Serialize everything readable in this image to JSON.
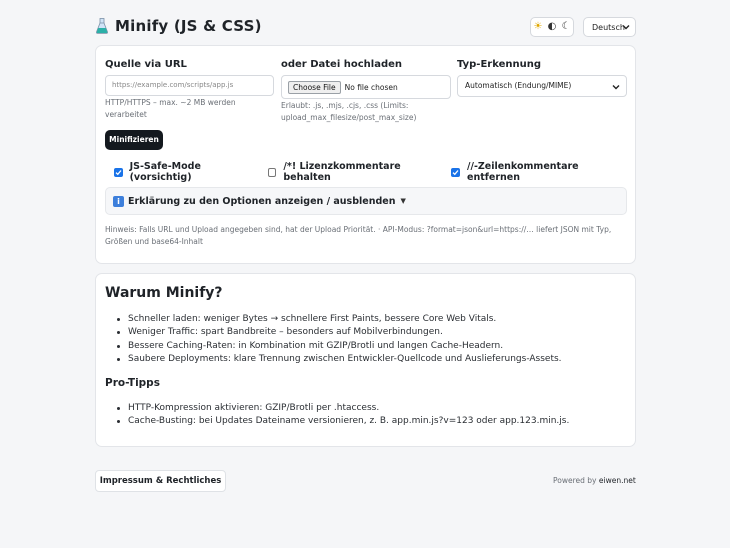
{
  "header": {
    "title": "Minify (JS & CSS)",
    "theme_buttons": [
      {
        "icon": "sun-icon",
        "glyph": "☀"
      },
      {
        "icon": "half-circle-icon",
        "glyph": "◐"
      },
      {
        "icon": "moon-icon",
        "glyph": "☾"
      }
    ],
    "language": "Deutsch"
  },
  "form": {
    "url_label": "Quelle via URL",
    "url_placeholder": "https://example.com/scripts/app.js",
    "url_hint": "HTTP/HTTPS – max. ~2 MB werden verarbeitet",
    "upload_label": "oder Datei hochladen",
    "file_button": "Choose File",
    "file_status": "No file chosen",
    "upload_hint": "Erlaubt: .js, .mjs, .cjs, .css (Limits: upload_max_filesize/post_max_size)",
    "type_label": "Typ-Erkennung",
    "type_value": "Automatisch (Endung/MIME)",
    "submit_label": "Minifizieren",
    "options": [
      {
        "label": "JS-Safe-Mode (vorsichtig)",
        "checked": true
      },
      {
        "label": "/*! Lizenzkommentare behalten",
        "checked": false
      },
      {
        "label": "//-Zeilenkommentare entfernen",
        "checked": true
      }
    ],
    "details_label": "Erklärung zu den Optionen anzeigen / ausblenden",
    "details_marker": "▼",
    "footnote": "Hinweis: Falls URL und Upload angegeben sind, hat der Upload Priorität. · API-Modus: ?format=json&url=https://… liefert JSON mit Typ, Größen und base64-Inhalt"
  },
  "why": {
    "heading": "Warum Minify?",
    "items": [
      "Schneller laden: weniger Bytes → schnellere First Paints, bessere Core Web Vitals.",
      "Weniger Traffic: spart Bandbreite – besonders auf Mobilverbindungen.",
      "Bessere Caching-Raten: in Kombination mit GZIP/Brotli und langen Cache-Headern.",
      "Saubere Deployments: klare Trennung zwischen Entwickler-Quellcode und Auslieferungs-Assets."
    ],
    "tips_heading": "Pro-Tipps",
    "tips": [
      "HTTP-Kompression aktivieren: GZIP/Brotli per .htaccess.",
      "Cache-Busting: bei Updates Dateiname versionieren, z. B. app.min.js?v=123 oder app.123.min.js."
    ]
  },
  "footer": {
    "imprint_label": "Impressum & Rechtliches",
    "powered_prefix": "Powered by",
    "powered_link": "eiwen.net"
  },
  "colors": {
    "accent": "#1a73e8",
    "primary_button": "#14191f",
    "background": "#f5f6f8"
  }
}
